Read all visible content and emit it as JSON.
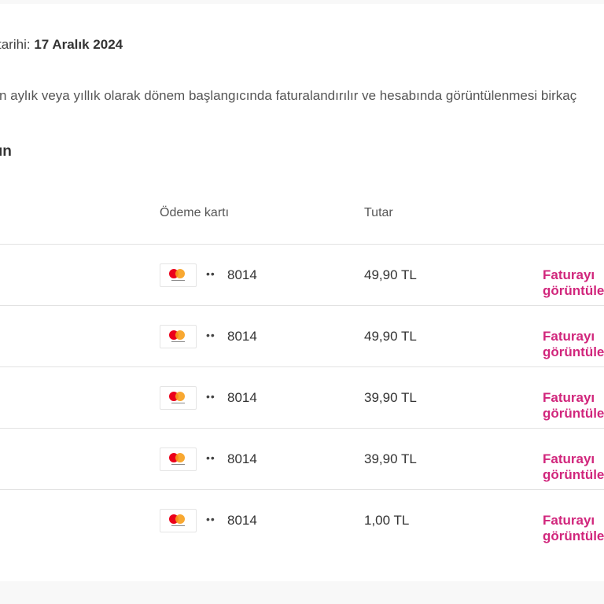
{
  "payment_date": {
    "label": "tarihi:",
    "value": "17 Aralık 2024"
  },
  "description": "n aylık veya yıllık olarak dönem başlangıcında faturalandırılır ve hesabında görüntülenmesi birkaç",
  "section_heading": "ın",
  "table": {
    "headers": {
      "card": "Ödeme kartı",
      "amount": "Tutar"
    },
    "rows": [
      {
        "card_brand": "mastercard",
        "masked": "••",
        "last4": "8014",
        "amount": "49,90 TL",
        "link": "Faturayı görüntüle"
      },
      {
        "card_brand": "mastercard",
        "masked": "••",
        "last4": "8014",
        "amount": "49,90 TL",
        "link": "Faturayı görüntüle"
      },
      {
        "card_brand": "mastercard",
        "masked": "••",
        "last4": "8014",
        "amount": "39,90 TL",
        "link": "Faturayı görüntüle"
      },
      {
        "card_brand": "mastercard",
        "masked": "••",
        "last4": "8014",
        "amount": "39,90 TL",
        "link": "Faturayı görüntüle"
      },
      {
        "card_brand": "mastercard",
        "masked": "••",
        "last4": "8014",
        "amount": "1,00 TL",
        "link": "Faturayı görüntüle"
      }
    ]
  },
  "colors": {
    "link": "#d1267c",
    "divider": "#e2e2e2"
  }
}
